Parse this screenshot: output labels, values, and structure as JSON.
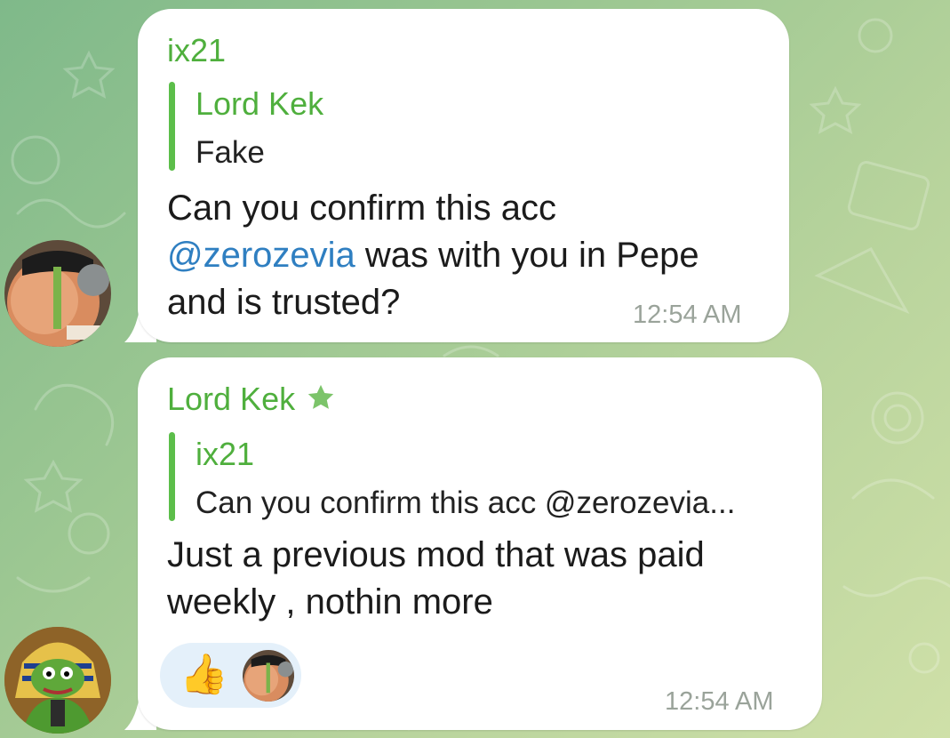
{
  "messages": [
    {
      "sender": "ix21",
      "reply": {
        "name": "Lord Kek",
        "text": "Fake"
      },
      "text_line1": "Can you confirm this acc",
      "mention": "@zerozevia",
      "text_line2_rest": " was with you in Pepe",
      "text_line3": "and is trusted?",
      "time": "12:54 AM"
    },
    {
      "sender": "Lord Kek",
      "sender_badge_icon": "star-icon",
      "reply": {
        "name": "ix21",
        "text": "Can you confirm this acc @zerozevia..."
      },
      "text_line1": "Just a previous mod that was paid",
      "text_line2": "weekly , nothin more",
      "reaction": {
        "emoji": "👍",
        "icon": "thumbs-up-icon"
      },
      "time": "12:54 AM"
    }
  ],
  "colors": {
    "sender_green": "#4faf3d",
    "mention_blue": "#2f7fc1",
    "reaction_bg": "#e4f0fa",
    "time_gray": "#9aa39a"
  }
}
